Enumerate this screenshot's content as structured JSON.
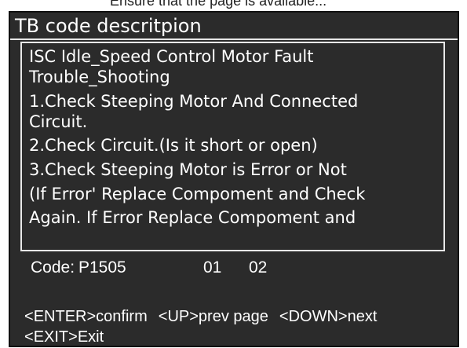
{
  "top_strip": {
    "text": "Ensure that the page is available..."
  },
  "header": {
    "title": "TB code descritpion"
  },
  "description": {
    "lines": [
      "ISC Idle_Speed Control Motor Fault",
      "Trouble_Shooting",
      "1.Check Steeping Motor And Connected",
      "Circuit.",
      "2.Check Circuit.(Is  it short or open)",
      "3.Check Steeping Motor is Error or Not",
      "(If Error' Replace Compoment and Check",
      "Again. If Error Replace Compoment and"
    ]
  },
  "code": {
    "label": "Code:",
    "value": "P1505",
    "field1": "01",
    "field2": "02"
  },
  "keys": {
    "enter": {
      "key": "ENTER",
      "action": "confirm"
    },
    "up": {
      "key": "UP",
      "action": "prev page"
    },
    "down": {
      "key": "DOWN",
      "action": "next"
    },
    "exit": {
      "key": "EXIT",
      "action": "Exit"
    }
  },
  "colors": {
    "screen_bg": "#2b2b2b",
    "text": "#ffffff",
    "border": "#e8e8e8"
  }
}
